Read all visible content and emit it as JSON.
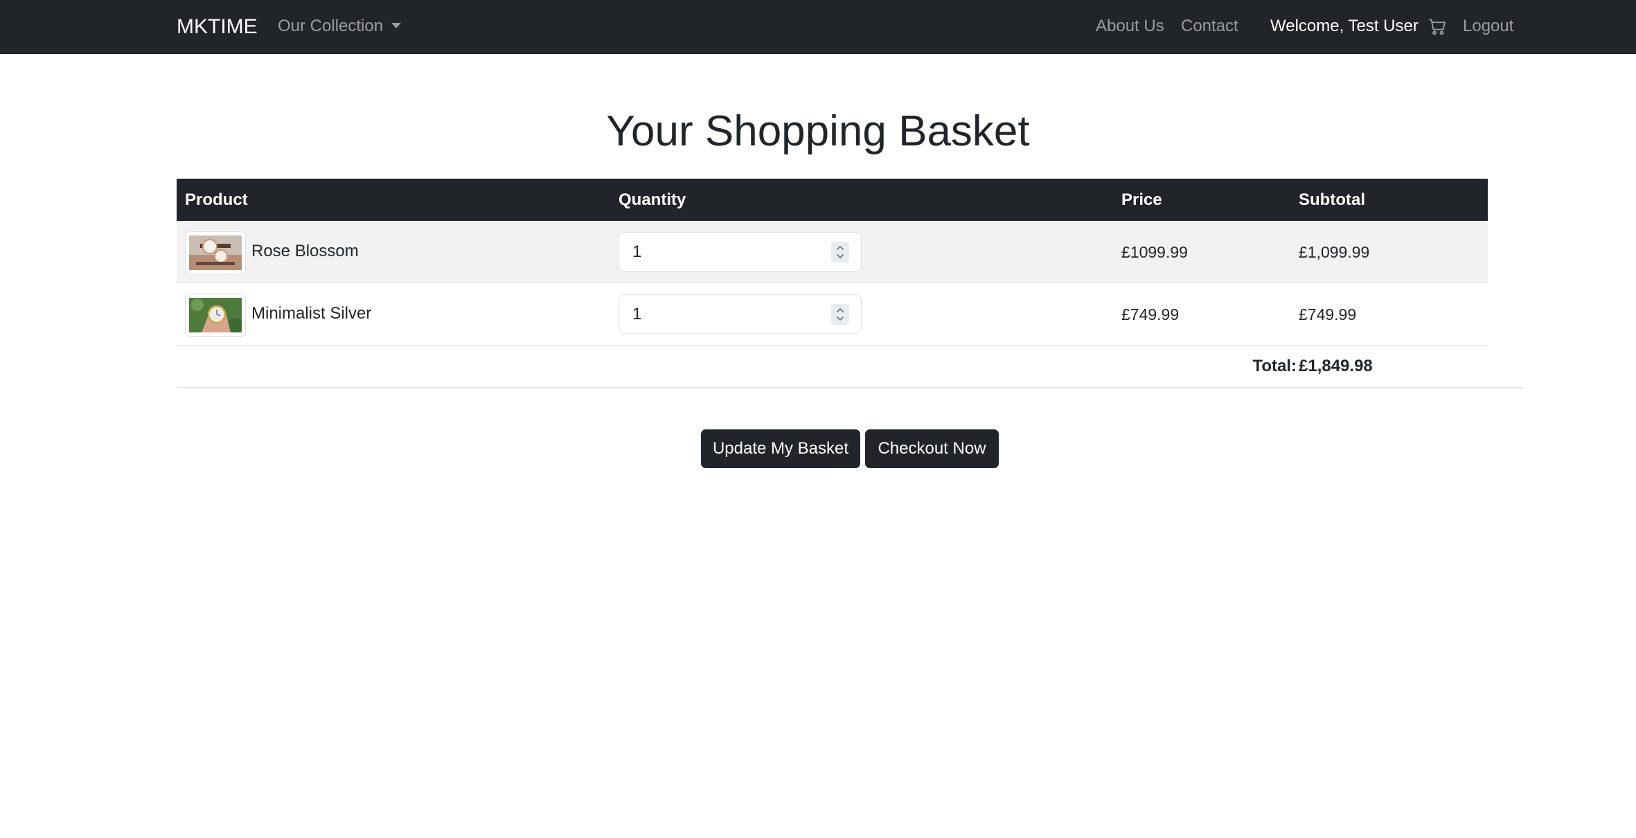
{
  "navbar": {
    "brand": "MKTIME",
    "collection_label": "Our Collection",
    "about_label": "About Us",
    "contact_label": "Contact",
    "welcome_text": "Welcome, Test User",
    "cart_icon": "cart-icon",
    "logout_label": "Logout"
  },
  "page": {
    "title": "Your Shopping Basket"
  },
  "table": {
    "headers": [
      "Product",
      "Quantity",
      "Price",
      "Subtotal"
    ],
    "rows": [
      {
        "thumbnail": "rose-blossom-watch-thumbnail",
        "name": "Rose Blossom",
        "quantity": "1",
        "price": "£1099.99",
        "subtotal": "£1,099.99"
      },
      {
        "thumbnail": "minimalist-silver-watch-thumbnail",
        "name": "Minimalist Silver",
        "quantity": "1",
        "price": "£749.99",
        "subtotal": "£749.99"
      }
    ],
    "total_label": "Total:",
    "total_value": "£1,849.98"
  },
  "actions": {
    "update_label": "Update My Basket",
    "checkout_label": "Checkout Now"
  },
  "colors": {
    "navbar_bg": "#212529",
    "table_header_bg": "#212529",
    "button_bg": "#212529",
    "striped_row_bg": "#f2f2f2"
  }
}
